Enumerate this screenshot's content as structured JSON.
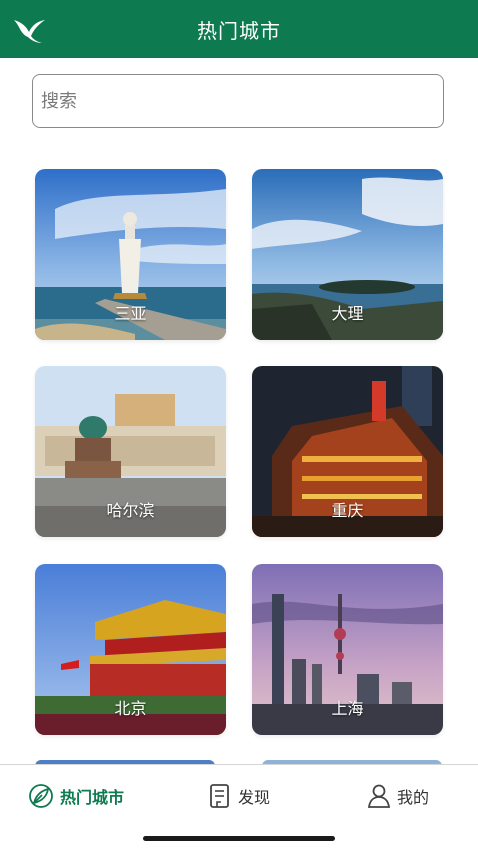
{
  "header": {
    "title": "热门城市",
    "logo_icon": "bird-icon",
    "color": "#0d7a4f"
  },
  "search": {
    "placeholder": "搜索",
    "value": ""
  },
  "cities": [
    {
      "name": "三亚",
      "scene": "guanyin-statue-sea"
    },
    {
      "name": "大理",
      "scene": "lake-island-sky"
    },
    {
      "name": "哈尔滨",
      "scene": "cathedral-square"
    },
    {
      "name": "重庆",
      "scene": "night-hongyadong"
    },
    {
      "name": "北京",
      "scene": "tiananmen"
    },
    {
      "name": "上海",
      "scene": "pudong-skyline"
    }
  ],
  "tabbar": {
    "tabs": [
      {
        "label": "热门城市",
        "icon": "leaf-icon",
        "active": true
      },
      {
        "label": "发现",
        "icon": "notebook-icon",
        "active": false
      },
      {
        "label": "我的",
        "icon": "user-icon",
        "active": false
      }
    ],
    "accent": "#0d7a4f"
  }
}
